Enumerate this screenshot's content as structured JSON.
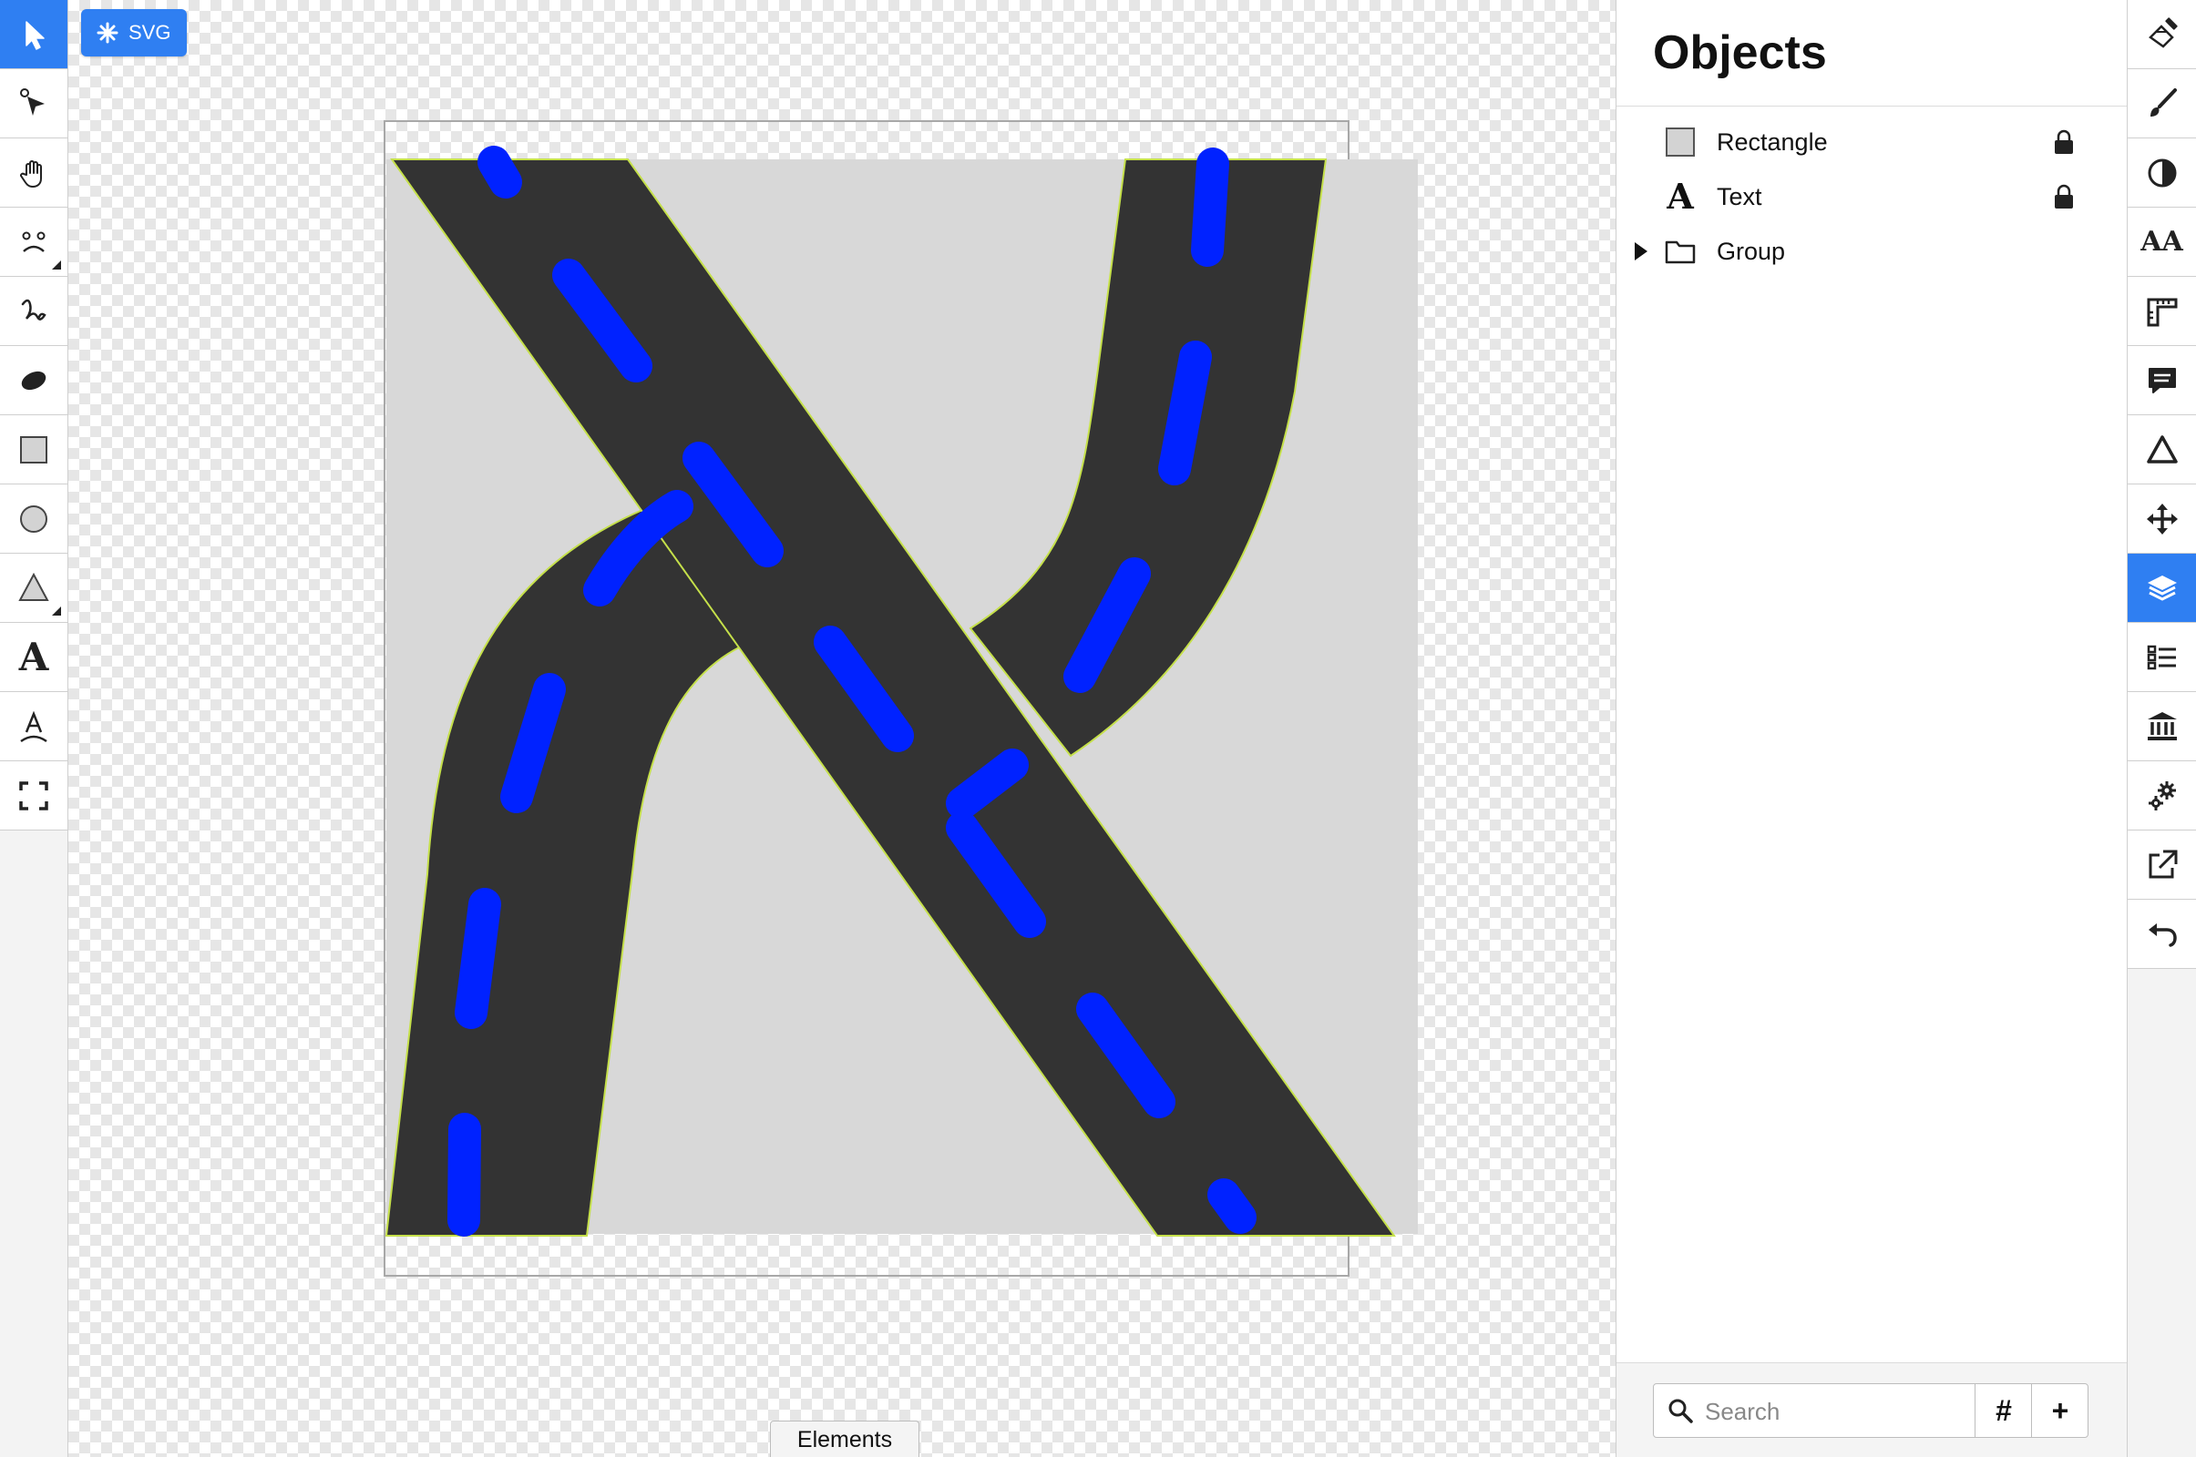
{
  "canvas": {
    "badge_label": "SVG",
    "elements_tab_label": "Elements",
    "colors": {
      "road": "#333333",
      "lane_dash": "#0022ff",
      "background_rect": "#d8d8d8",
      "road_outline": "#c5e04a",
      "accent": "#2f7ff2"
    }
  },
  "left_toolbar": {
    "tools": [
      {
        "name": "select-tool",
        "icon": "pointer-arrow-icon",
        "active": true
      },
      {
        "name": "node-edit-tool",
        "icon": "node-pointer-icon"
      },
      {
        "name": "pan-tool",
        "icon": "hand-icon"
      },
      {
        "name": "shapes-tool",
        "icon": "face-icon"
      },
      {
        "name": "freehand-tool",
        "icon": "squiggle-icon"
      },
      {
        "name": "ellipse-tool",
        "icon": "ellipse-icon"
      },
      {
        "name": "rectangle-tool",
        "icon": "square-icon"
      },
      {
        "name": "circle-tool",
        "icon": "circle-icon"
      },
      {
        "name": "polygon-tool",
        "icon": "triangle-icon"
      },
      {
        "name": "text-tool",
        "icon": "letter-a-icon",
        "glyph": "A"
      },
      {
        "name": "text-path-tool",
        "icon": "text-on-path-icon",
        "glyph": "A"
      },
      {
        "name": "fullscreen-tool",
        "icon": "fullscreen-corners-icon"
      }
    ]
  },
  "objects_panel": {
    "title": "Objects",
    "items": [
      {
        "label": "Rectangle",
        "icon": "rectangle-swatch-icon",
        "locked": true
      },
      {
        "label": "Text",
        "icon": "text-a-icon",
        "glyph": "A",
        "locked": true
      },
      {
        "label": "Group",
        "icon": "folder-icon",
        "expandable": true
      }
    ],
    "search": {
      "placeholder": "Search"
    },
    "footer_buttons": [
      "#",
      "+"
    ]
  },
  "right_toolbar": {
    "tools": [
      {
        "name": "fill-tool",
        "icon": "paint-bucket-icon"
      },
      {
        "name": "stroke-tool",
        "icon": "brush-icon"
      },
      {
        "name": "contrast-tool",
        "icon": "half-circle-icon"
      },
      {
        "name": "typography-tool",
        "icon": "font-size-icon",
        "glyph": "AA"
      },
      {
        "name": "ruler-tool",
        "icon": "ruler-icon"
      },
      {
        "name": "comment-tool",
        "icon": "speech-bubble-icon"
      },
      {
        "name": "geometry-tool",
        "icon": "triangle-outline-icon"
      },
      {
        "name": "transform-tool",
        "icon": "move-arrows-icon"
      },
      {
        "name": "layers-tool",
        "icon": "layers-icon",
        "active": true
      },
      {
        "name": "list-tool",
        "icon": "list-icon"
      },
      {
        "name": "library-tool",
        "icon": "bank-icon"
      },
      {
        "name": "settings-tool",
        "icon": "gears-icon"
      },
      {
        "name": "export-tool",
        "icon": "external-link-icon"
      },
      {
        "name": "undo-tool",
        "icon": "undo-icon"
      }
    ]
  }
}
